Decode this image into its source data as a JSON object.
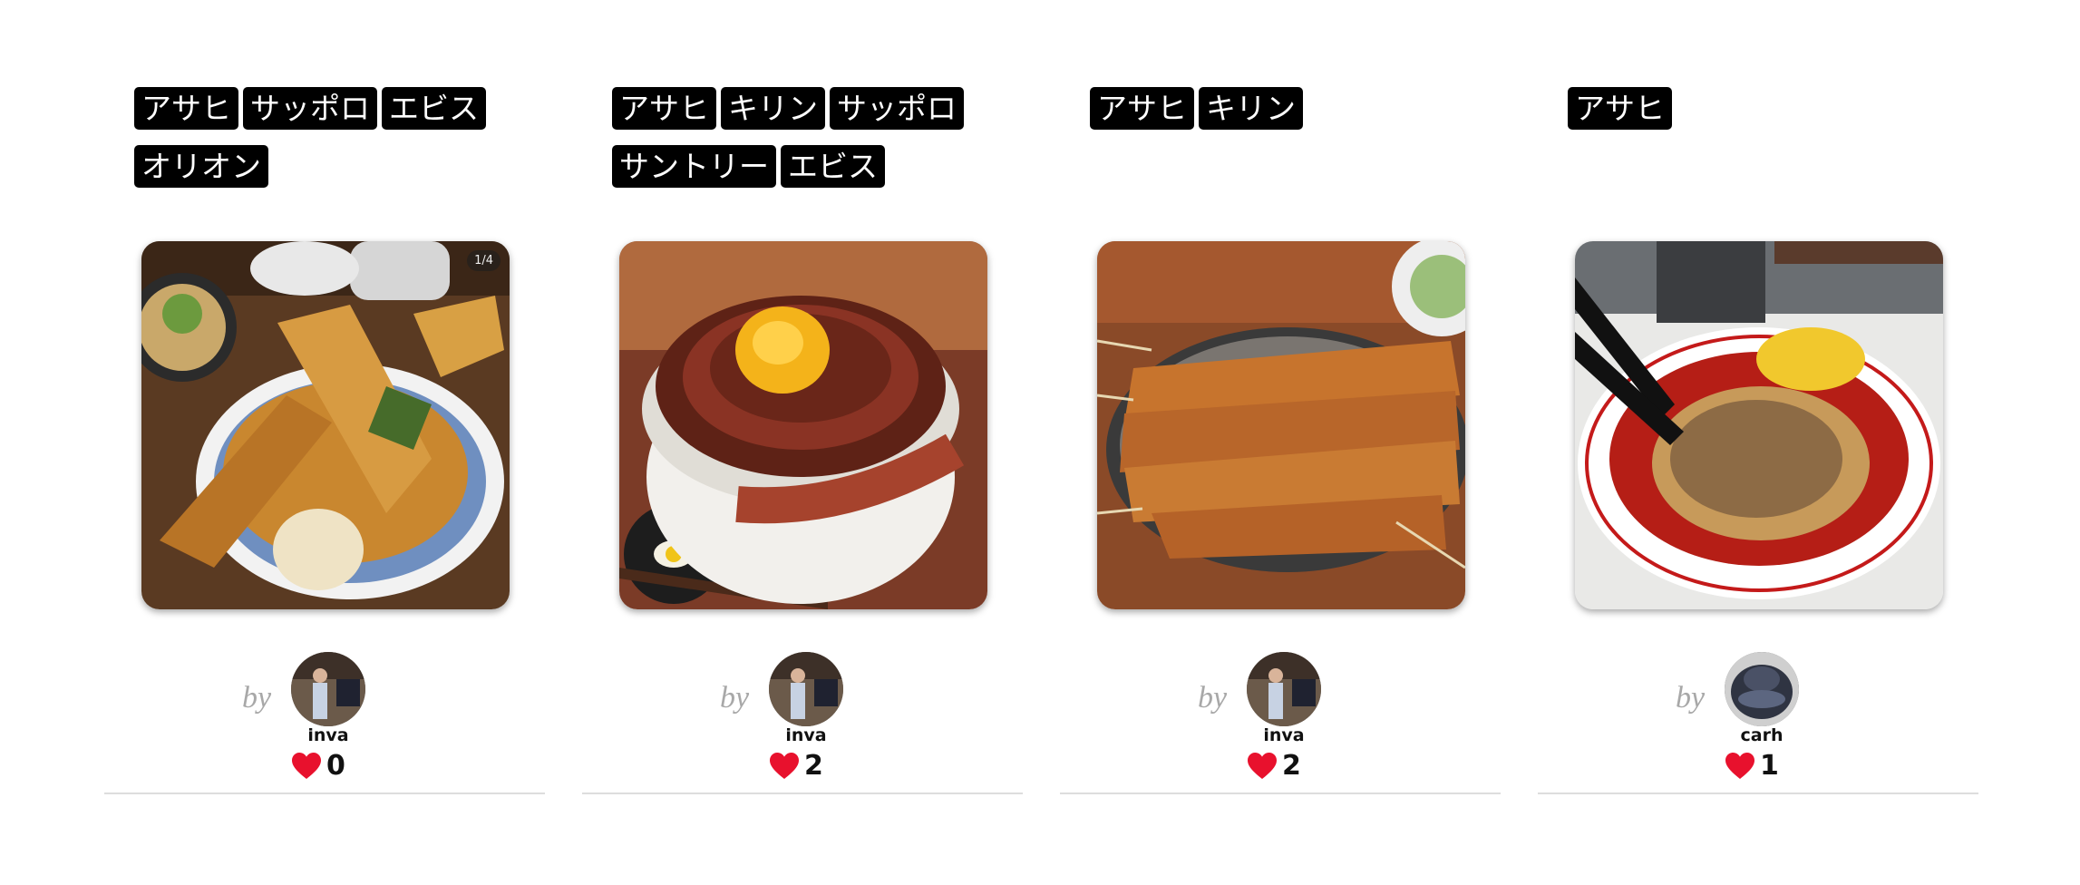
{
  "posts": [
    {
      "tags": [
        "アサヒ",
        "サッポロ",
        "エビス",
        "オリオン"
      ],
      "photo_icon": "tempura-bowl-photo",
      "photo_counter": "1/4",
      "by_label": "by",
      "username": "inva",
      "likes": "0"
    },
    {
      "tags": [
        "アサヒ",
        "キリン",
        "サッポロ",
        "サントリー",
        "エビス"
      ],
      "photo_icon": "sausage-egg-bowl-photo",
      "by_label": "by",
      "username": "inva",
      "likes": "2"
    },
    {
      "tags": [
        "アサヒ",
        "キリン"
      ],
      "photo_icon": "kushikatsu-skewers-photo",
      "by_label": "by",
      "username": "inva",
      "likes": "2"
    },
    {
      "tags": [
        "アサヒ"
      ],
      "photo_icon": "spicy-ramen-photo",
      "by_label": "by",
      "username": "carh",
      "likes": "1"
    }
  ],
  "colors": {
    "tag_background": "#000000",
    "heart": "#e8112d",
    "by_text": "#a8a8a8",
    "divider": "#dddddd"
  }
}
